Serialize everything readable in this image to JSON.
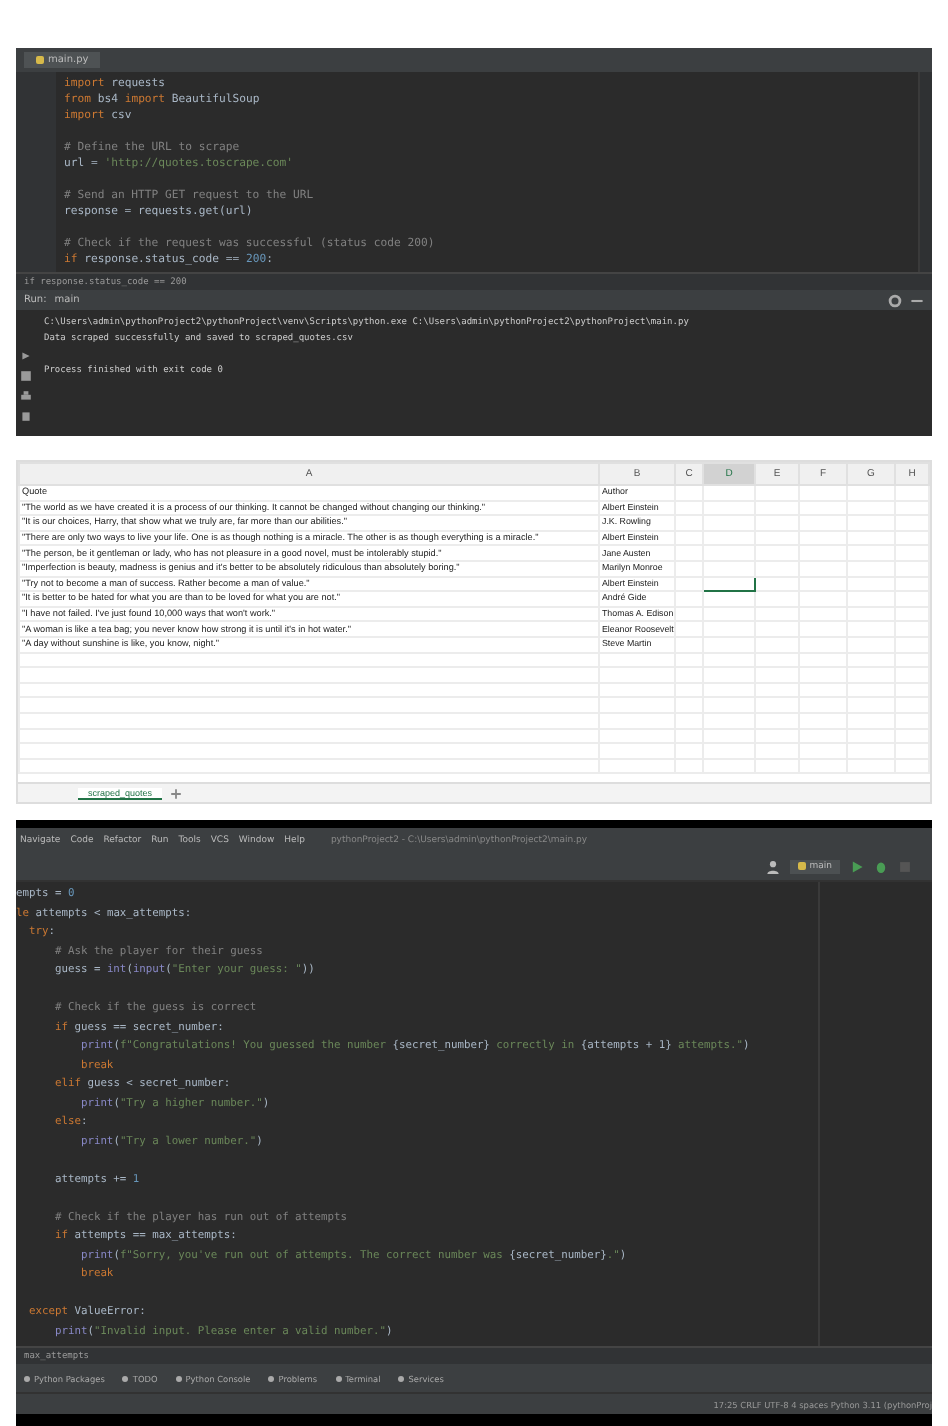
{
  "top_ide": {
    "tab": "main.py",
    "code": [
      {
        "kind": "code",
        "tokens": [
          {
            "kind": "keyword",
            "t": "import"
          },
          {
            "kind": "plain",
            "t": " requests"
          }
        ]
      },
      {
        "kind": "code",
        "tokens": [
          {
            "kind": "keyword",
            "t": "from"
          },
          {
            "kind": "plain",
            "t": " bs4 "
          },
          {
            "kind": "keyword",
            "t": "import"
          },
          {
            "kind": "plain",
            "t": " BeautifulSoup"
          }
        ]
      },
      {
        "kind": "code",
        "tokens": [
          {
            "kind": "keyword",
            "t": "import"
          },
          {
            "kind": "plain",
            "t": " csv"
          }
        ]
      },
      {
        "kind": "blank"
      },
      {
        "kind": "code",
        "tokens": [
          {
            "kind": "comment",
            "t": "# Define the URL to scrape"
          }
        ]
      },
      {
        "kind": "code",
        "tokens": [
          {
            "kind": "plain",
            "t": "url = "
          },
          {
            "kind": "string",
            "t": "'http://quotes.toscrape.com'"
          }
        ]
      },
      {
        "kind": "blank"
      },
      {
        "kind": "code",
        "tokens": [
          {
            "kind": "comment",
            "t": "# Send an HTTP GET request to the URL"
          }
        ]
      },
      {
        "kind": "code",
        "tokens": [
          {
            "kind": "plain",
            "t": "response = requests.get(url)"
          }
        ]
      },
      {
        "kind": "blank"
      },
      {
        "kind": "code",
        "tokens": [
          {
            "kind": "comment",
            "t": "# Check if the request was successful (status code 200)"
          }
        ]
      },
      {
        "kind": "code",
        "tokens": [
          {
            "kind": "keyword",
            "t": "if"
          },
          {
            "kind": "plain",
            "t": " response.status_code == "
          },
          {
            "kind": "number",
            "t": "200"
          },
          {
            "kind": "plain",
            "t": ":"
          }
        ]
      }
    ],
    "breadcrumb": "if response.status_code == 200",
    "run_title": "Run:",
    "run_tab": "main",
    "output": [
      {
        "kind": "text",
        "text": "C:\\Users\\admin\\pythonProject2\\pythonProject\\venv\\Scripts\\python.exe C:\\Users\\admin\\pythonProject2\\pythonProject\\main.py"
      },
      {
        "kind": "text",
        "text": "Data scraped successfully and saved to scraped_quotes.csv"
      },
      {
        "kind": "blank"
      },
      {
        "kind": "text",
        "text": "Process finished with exit code 0"
      }
    ]
  },
  "sheet": {
    "columns": [
      {
        "label": "A",
        "selected": false
      },
      {
        "label": "B",
        "selected": false
      },
      {
        "label": "C",
        "selected": false
      },
      {
        "label": "D",
        "selected": true
      },
      {
        "label": "E",
        "selected": false
      },
      {
        "label": "F",
        "selected": false
      },
      {
        "label": "G",
        "selected": false
      },
      {
        "label": "H",
        "selected": false
      }
    ],
    "rows": [
      {
        "quote": "Quote",
        "author": "Author",
        "selected": false
      },
      {
        "quote": "\"The world as we have created it is a process of our thinking. It cannot be changed without changing our thinking.\"",
        "author": "Albert Einstein",
        "selected": false
      },
      {
        "quote": "\"It is our choices, Harry, that show what we truly are, far more than our abilities.\"",
        "author": "J.K. Rowling",
        "selected": false
      },
      {
        "quote": "\"There are only two ways to live your life. One is as though nothing is a miracle. The other is as though everything is a miracle.\"",
        "author": "Albert Einstein",
        "selected": false
      },
      {
        "quote": "\"The person, be it gentleman or lady, who has not pleasure in a good novel, must be intolerably stupid.\"",
        "author": "Jane Austen",
        "selected": false
      },
      {
        "quote": "\"Imperfection is beauty, madness is genius and it's better to be absolutely ridiculous than absolutely boring.\"",
        "author": "Marilyn Monroe",
        "selected": false
      },
      {
        "quote": "\"Try not to become a man of success. Rather become a man of value.\"",
        "author": "Albert Einstein",
        "selected": true
      },
      {
        "quote": "\"It is better to be hated for what you are than to be loved for what you are not.\"",
        "author": "André Gide",
        "selected": false
      },
      {
        "quote": "\"I have not failed. I've just found 10,000 ways that won't work.\"",
        "author": "Thomas A. Edison",
        "selected": false
      },
      {
        "quote": "\"A woman is like a tea bag; you never know how strong it is until it's in hot water.\"",
        "author": "Eleanor Roosevelt",
        "selected": false
      },
      {
        "quote": "\"A day without sunshine is like, you know, night.\"",
        "author": "Steve Martin",
        "selected": false
      }
    ],
    "sheet_tab": "scraped_quotes"
  },
  "bottom_ide": {
    "menu": [
      "Navigate",
      "Code",
      "Refactor",
      "Run",
      "Tools",
      "VCS",
      "Window",
      "Help"
    ],
    "title": "pythonProject2 - C:\\Users\\admin\\pythonProject2\\main.py",
    "run_config": "main",
    "code": [
      {
        "kind": "code",
        "tokens": [
          {
            "kind": "plain",
            "t": "empts = "
          },
          {
            "kind": "number",
            "t": "0"
          }
        ]
      },
      {
        "kind": "code",
        "tokens": [
          {
            "kind": "keyword",
            "t": "le"
          },
          {
            "kind": "plain",
            "t": " attempts < max_attempts:"
          }
        ]
      },
      {
        "kind": "code",
        "tokens": [
          {
            "kind": "keyword",
            "t": "  try"
          },
          {
            "kind": "plain",
            "t": ":"
          }
        ]
      },
      {
        "kind": "code",
        "tokens": [
          {
            "kind": "comment",
            "t": "      # Ask the player for their guess"
          }
        ]
      },
      {
        "kind": "code",
        "tokens": [
          {
            "kind": "plain",
            "t": "      guess = "
          },
          {
            "kind": "builtin",
            "t": "int"
          },
          {
            "kind": "plain",
            "t": "("
          },
          {
            "kind": "builtin",
            "t": "input"
          },
          {
            "kind": "plain",
            "t": "("
          },
          {
            "kind": "string",
            "t": "\"Enter your guess: \""
          },
          {
            "kind": "plain",
            "t": "))"
          }
        ]
      },
      {
        "kind": "blank"
      },
      {
        "kind": "code",
        "tokens": [
          {
            "kind": "comment",
            "t": "      # Check if the guess is correct"
          }
        ]
      },
      {
        "kind": "code",
        "tokens": [
          {
            "kind": "keyword",
            "t": "      if"
          },
          {
            "kind": "plain",
            "t": " guess == secret_number:"
          }
        ]
      },
      {
        "kind": "code",
        "tokens": [
          {
            "kind": "builtin",
            "t": "          print"
          },
          {
            "kind": "plain",
            "t": "("
          },
          {
            "kind": "string",
            "t": "f\"Congratulations! You guessed the number "
          },
          {
            "kind": "plain",
            "t": "{secret_number}"
          },
          {
            "kind": "string",
            "t": " correctly in "
          },
          {
            "kind": "plain",
            "t": "{attempts + 1}"
          },
          {
            "kind": "string",
            "t": " attempts.\""
          },
          {
            "kind": "plain",
            "t": ")"
          }
        ]
      },
      {
        "kind": "code",
        "tokens": [
          {
            "kind": "keyword",
            "t": "          break"
          }
        ]
      },
      {
        "kind": "code",
        "tokens": [
          {
            "kind": "keyword",
            "t": "      elif"
          },
          {
            "kind": "plain",
            "t": " guess < secret_number:"
          }
        ]
      },
      {
        "kind": "code",
        "tokens": [
          {
            "kind": "builtin",
            "t": "          print"
          },
          {
            "kind": "plain",
            "t": "("
          },
          {
            "kind": "string",
            "t": "\"Try a higher number.\""
          },
          {
            "kind": "plain",
            "t": ")"
          }
        ]
      },
      {
        "kind": "code",
        "tokens": [
          {
            "kind": "keyword",
            "t": "      else"
          },
          {
            "kind": "plain",
            "t": ":"
          }
        ]
      },
      {
        "kind": "code",
        "tokens": [
          {
            "kind": "builtin",
            "t": "          print"
          },
          {
            "kind": "plain",
            "t": "("
          },
          {
            "kind": "string",
            "t": "\"Try a lower number.\""
          },
          {
            "kind": "plain",
            "t": ")"
          }
        ]
      },
      {
        "kind": "blank"
      },
      {
        "kind": "code",
        "tokens": [
          {
            "kind": "plain",
            "t": "      attempts += "
          },
          {
            "kind": "number",
            "t": "1"
          }
        ]
      },
      {
        "kind": "blank"
      },
      {
        "kind": "code",
        "tokens": [
          {
            "kind": "comment",
            "t": "      # Check if the player has run out of attempts"
          }
        ]
      },
      {
        "kind": "code",
        "tokens": [
          {
            "kind": "keyword",
            "t": "      if"
          },
          {
            "kind": "plain",
            "t": " attempts == max_attempts:"
          }
        ]
      },
      {
        "kind": "code",
        "tokens": [
          {
            "kind": "builtin",
            "t": "          print"
          },
          {
            "kind": "plain",
            "t": "("
          },
          {
            "kind": "string",
            "t": "f\"Sorry, you've run out of attempts. The correct number was "
          },
          {
            "kind": "plain",
            "t": "{secret_number}"
          },
          {
            "kind": "string",
            "t": ".\""
          },
          {
            "kind": "plain",
            "t": ")"
          }
        ]
      },
      {
        "kind": "code",
        "tokens": [
          {
            "kind": "keyword",
            "t": "          break"
          }
        ]
      },
      {
        "kind": "blank"
      },
      {
        "kind": "code",
        "tokens": [
          {
            "kind": "keyword",
            "t": "  except"
          },
          {
            "kind": "plain",
            "t": " ValueError:"
          }
        ]
      },
      {
        "kind": "code",
        "tokens": [
          {
            "kind": "builtin",
            "t": "      print"
          },
          {
            "kind": "plain",
            "t": "("
          },
          {
            "kind": "string",
            "t": "\"Invalid input. Please enter a valid number.\""
          },
          {
            "kind": "plain",
            "t": ")"
          }
        ]
      }
    ],
    "breadcrumb": "max_attempts",
    "tools": [
      "Python Packages",
      "TODO",
      "Python Console",
      "Problems",
      "Terminal",
      "Services"
    ],
    "status": "17:25  CRLF  UTF-8  4 spaces  Python 3.11 (pythonProj"
  }
}
